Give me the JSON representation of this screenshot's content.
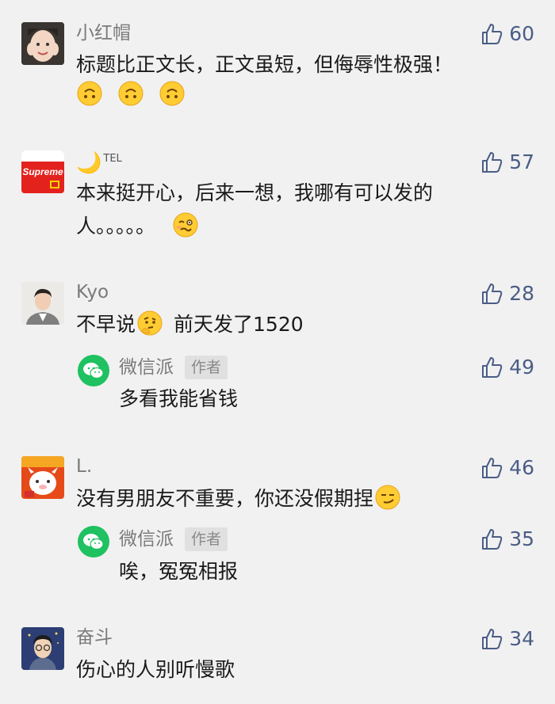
{
  "comments": [
    {
      "name": "小红帽",
      "text": "标题比正文长，正文虽短，但侮辱性极强！",
      "likes": "60",
      "emojis": [
        "upside-down-face",
        "upside-down-face",
        "upside-down-face"
      ]
    },
    {
      "name_symbol": "🌙",
      "name_sup": "TEL",
      "text_line1": "本来挺开心，后来一想，我哪有可以发的",
      "text_line2": "人。。。。。",
      "likes": "57",
      "avatar_text": "Supreme"
    },
    {
      "name": "Kyo",
      "text_before": "不早说",
      "text_after": "前天发了1520",
      "likes": "28",
      "reply": {
        "name": "微信派",
        "tag": "作者",
        "text": "多看我能省钱",
        "likes": "49"
      }
    },
    {
      "name": "L.",
      "text": "没有男朋友不重要，你还没假期捏",
      "likes": "46",
      "reply": {
        "name": "微信派",
        "tag": "作者",
        "text": "唉，冤冤相报",
        "likes": "35"
      }
    },
    {
      "name": "奋斗",
      "text": "伤心的人别听慢歌",
      "likes": "34"
    }
  ],
  "colors": {
    "background": "#f1f1f1",
    "like_blue": "#4b5d86",
    "wechat_green": "#1fc160"
  }
}
